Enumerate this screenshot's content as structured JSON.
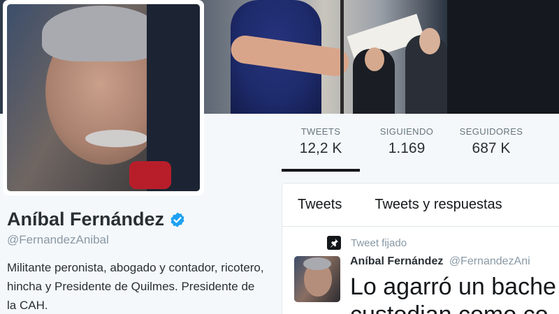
{
  "profile": {
    "name": "Aníbal Fernández",
    "handle": "@FernandezAnibal",
    "bio": "Militante peronista, abogado y contador, ricotero, hincha y Presidente de Quilmes. Presidente de la CAH.",
    "verified_icon": "verified-badge-icon"
  },
  "stats": [
    {
      "label": "TWEETS",
      "value": "12,2 K",
      "active": true
    },
    {
      "label": "SIGUIENDO",
      "value": "1.169",
      "active": false
    },
    {
      "label": "SEGUIDORES",
      "value": "687 K",
      "active": false
    }
  ],
  "timeline": {
    "tabs": [
      {
        "label": "Tweets"
      },
      {
        "label": "Tweets y respuestas"
      }
    ],
    "pinned_label": "Tweet fijado",
    "tweet": {
      "name": "Aníbal Fernández",
      "handle": "@FernandezAni",
      "text_line1": "Lo agarró un bache",
      "text_line2": "custodian como co"
    }
  },
  "colors": {
    "accent_verified": "#1da1f2",
    "text_primary": "#292f33",
    "text_secondary": "#8899a6",
    "background": "#f5f8fa"
  }
}
